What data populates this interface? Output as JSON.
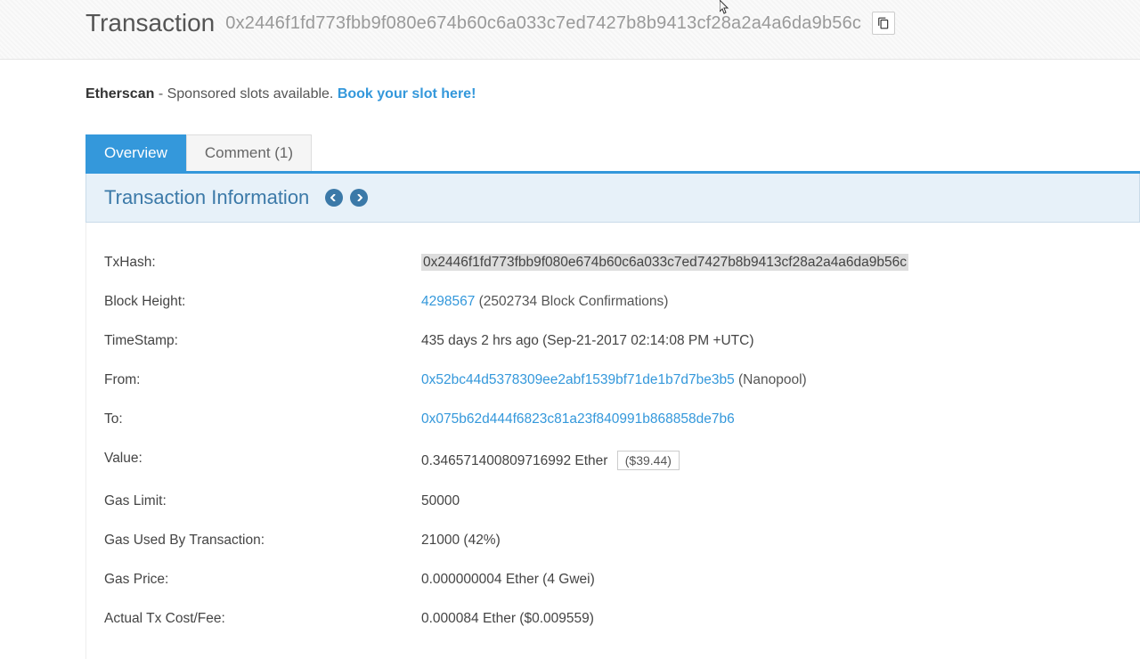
{
  "header": {
    "title": "Transaction",
    "hash": "0x2446f1fd773fbb9f080e674b60c6a033c7ed7427b8b9413cf28a2a4a6da9b56c"
  },
  "sponsor": {
    "brand": "Etherscan",
    "text": " - Sponsored slots available. ",
    "link": "Book your slot here!"
  },
  "tabs": {
    "overview": "Overview",
    "comment": "Comment (1)"
  },
  "panel": {
    "title": "Transaction Information"
  },
  "tx": {
    "txhash_label": "TxHash:",
    "txhash": "0x2446f1fd773fbb9f080e674b60c6a033c7ed7427b8b9413cf28a2a4a6da9b56c",
    "blockheight_label": "Block Height:",
    "blockheight_link": "4298567",
    "blockheight_conf": " (2502734 Block Confirmations)",
    "timestamp_label": "TimeStamp:",
    "timestamp": "435 days 2 hrs ago (Sep-21-2017 02:14:08 PM +UTC)",
    "from_label": "From:",
    "from_addr": "0x52bc44d5378309ee2abf1539bf71de1b7d7be3b5",
    "from_name": " (Nanopool)",
    "to_label": "To:",
    "to_addr": "0x075b62d444f6823c81a23f840991b868858de7b6",
    "value_label": "Value:",
    "value_eth": "0.346571400809716992 Ether ",
    "value_usd": "($39.44)",
    "gaslimit_label": "Gas Limit:",
    "gaslimit": "50000",
    "gasused_label": "Gas Used By Transaction:",
    "gasused": "21000 (42%)",
    "gasprice_label": "Gas Price:",
    "gasprice": "0.000000004 Ether (4 Gwei)",
    "fee_label": "Actual Tx Cost/Fee:",
    "fee": "0.000084 Ether ($0.009559)"
  }
}
